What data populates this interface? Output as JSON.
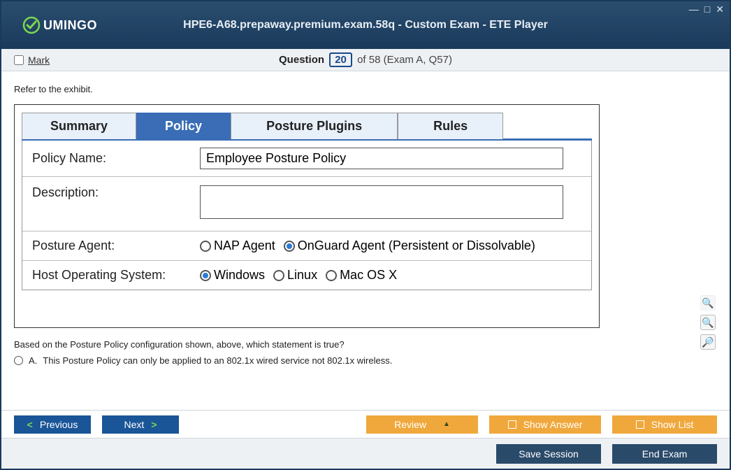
{
  "window": {
    "title": "HPE6-A68.prepaway.premium.exam.58q - Custom Exam - ETE Player"
  },
  "logo": {
    "text": "UMINGO"
  },
  "subbar": {
    "mark_label": "Mark",
    "question_label": "Question",
    "question_num": "20",
    "of_text": "of 58 (Exam A, Q57)"
  },
  "content": {
    "refer": "Refer to the exhibit.",
    "tabs": {
      "summary": "Summary",
      "policy": "Policy",
      "posture": "Posture Plugins",
      "rules": "Rules"
    },
    "form": {
      "policy_name_label": "Policy Name:",
      "policy_name_value": "Employee Posture Policy",
      "description_label": "Description:",
      "description_value": "",
      "posture_agent_label": "Posture Agent:",
      "agent_nap": "NAP Agent",
      "agent_onguard": "OnGuard Agent (Persistent or Dissolvable)",
      "host_os_label": "Host Operating System:",
      "os_windows": "Windows",
      "os_linux": "Linux",
      "os_mac": "Mac OS X"
    },
    "question": "Based on the Posture Policy configuration shown, above, which statement is true?",
    "answer_a_prefix": "A.",
    "answer_a": "This Posture Policy can only be applied to an 802.1x wired service not 802.1x wireless."
  },
  "footer": {
    "previous": "Previous",
    "next": "Next",
    "review": "Review",
    "show_answer": "Show Answer",
    "show_list": "Show List",
    "save_session": "Save Session",
    "end_exam": "End Exam"
  }
}
